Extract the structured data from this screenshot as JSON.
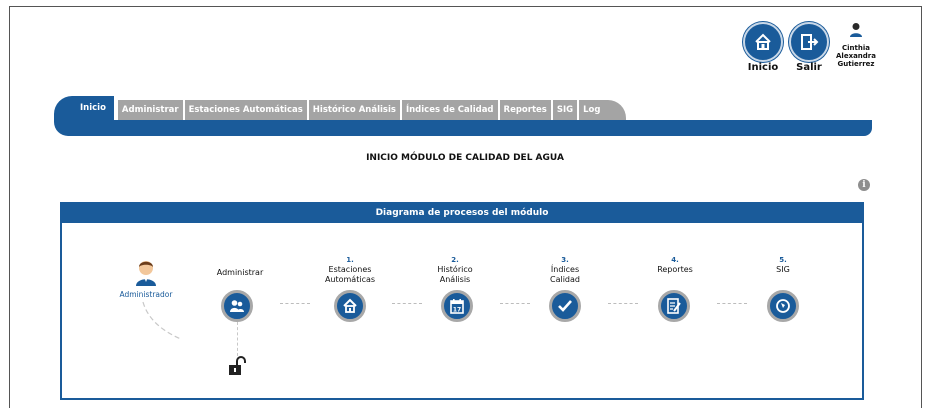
{
  "header": {
    "home_label": "Inicio",
    "exit_label": "Salir",
    "user_name_line1": "Cinthia",
    "user_name_line2": "Alexandra",
    "user_name_line3": "Gutierrez"
  },
  "tabs": [
    {
      "label": "Inicio",
      "active": true
    },
    {
      "label": "Administrar"
    },
    {
      "label": "Estaciones Automáticas"
    },
    {
      "label": "Histórico Análisis"
    },
    {
      "label": "Índices de Calidad"
    },
    {
      "label": "Reportes"
    },
    {
      "label": "SIG"
    },
    {
      "label": "Log"
    }
  ],
  "main_title": "INICIO MÓDULO DE CALIDAD DEL AGUA",
  "panel": {
    "title": "Diagrama de procesos del módulo",
    "admin_label": "Administrador",
    "steps": [
      {
        "num": "",
        "line1": "Administrar",
        "line2": "",
        "icon": "users-icon"
      },
      {
        "num": "1.",
        "line1": "Estaciones",
        "line2": "Automáticas",
        "icon": "home-icon"
      },
      {
        "num": "2.",
        "line1": "Histórico",
        "line2": "Análisis",
        "icon": "calendar-icon"
      },
      {
        "num": "3.",
        "line1": "Índices",
        "line2": "Calidad",
        "icon": "check-icon"
      },
      {
        "num": "4.",
        "line1": "Reportes",
        "line2": "",
        "icon": "report-icon"
      },
      {
        "num": "5.",
        "line1": "SIG",
        "line2": "",
        "icon": "globe-icon"
      }
    ]
  },
  "colors": {
    "primary": "#1a5b9a",
    "tab_inactive": "#a4a4a4"
  }
}
